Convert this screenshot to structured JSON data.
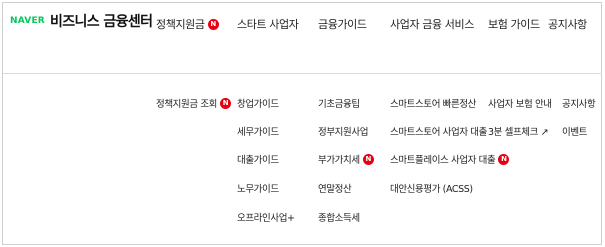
{
  "brand": {
    "naver": "NAVER",
    "name": "비즈니스 금융센터"
  },
  "colors": {
    "brand_green": "#03c75a",
    "new_badge": "#e60012"
  },
  "nav": [
    {
      "label": "정책지원금",
      "badge": "N"
    },
    {
      "label": "스타트 사업자"
    },
    {
      "label": "금융가이드"
    },
    {
      "label": "사업자 금융 서비스"
    },
    {
      "label": "보험 가이드"
    },
    {
      "label": "공지사항"
    }
  ],
  "submenu": {
    "policy": [
      {
        "label": "정책지원금 조회",
        "badge": "N"
      }
    ],
    "startup": [
      {
        "label": "창업가이드"
      },
      {
        "label": "세무가이드"
      },
      {
        "label": "대출가이드"
      },
      {
        "label": "노무가이드"
      },
      {
        "label": "오프라인사업+"
      }
    ],
    "finance_guide": [
      {
        "label": "기초금융팁"
      },
      {
        "label": "정부지원사업"
      },
      {
        "label": "부가가치세",
        "badge": "N"
      },
      {
        "label": "연말정산"
      },
      {
        "label": "종합소득세"
      }
    ],
    "business_finance": [
      {
        "label": "스마트스토어 빠른정산"
      },
      {
        "label": "스마트스토어 사업자 대출"
      },
      {
        "label": "스마트플레이스 사업자 대출",
        "badge": "N"
      },
      {
        "label": "대안신용평가 (ACSS)"
      }
    ],
    "insurance": [
      {
        "label": "사업자 보험 안내"
      },
      {
        "label": "3분 셀프체크 ↗"
      }
    ],
    "notice": [
      {
        "label": "공지사항"
      },
      {
        "label": "이벤트"
      }
    ]
  }
}
